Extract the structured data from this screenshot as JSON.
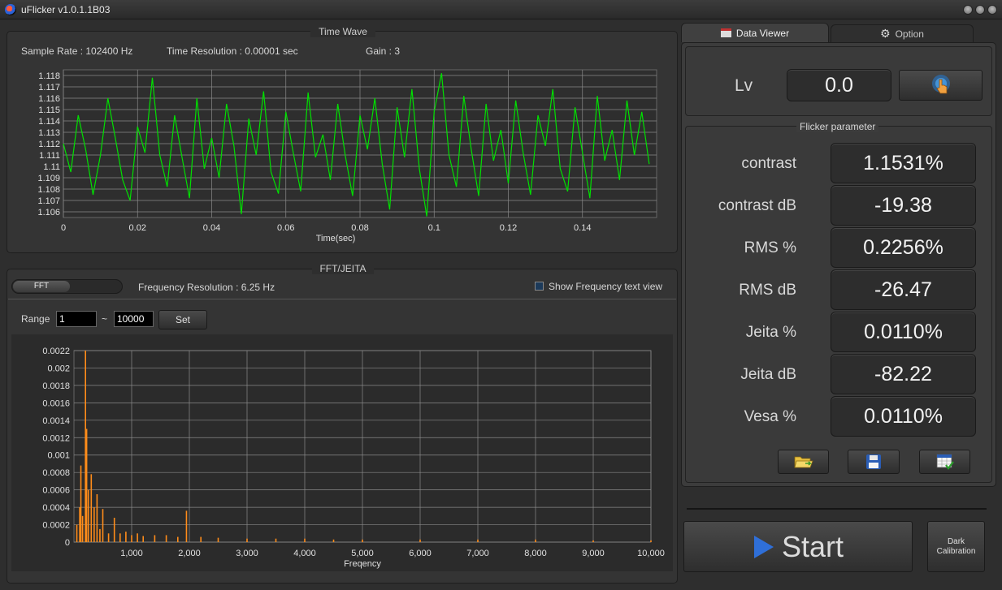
{
  "window": {
    "title": "uFlicker v1.0.1.1B03"
  },
  "time_wave": {
    "title": "Time Wave",
    "sample_rate": "Sample Rate : 102400 Hz",
    "time_resolution": "Time Resolution : 0.00001 sec",
    "gain": "Gain : 3"
  },
  "fft": {
    "title": "FFT/JEITA",
    "mode_label": "FFT",
    "frequency_resolution": "Frequency Resolution : 6.25 Hz",
    "show_text_view": "Show Frequency text view",
    "range_label": "Range",
    "range_from": "1",
    "range_sep": "~",
    "range_to": "10000",
    "set_label": "Set"
  },
  "tabs": {
    "data_viewer": "Data Viewer",
    "option": "Option"
  },
  "lv": {
    "label": "Lv",
    "value": "0.0"
  },
  "flicker": {
    "title": "Flicker parameter",
    "params": [
      {
        "label": "contrast",
        "value": "1.1531%"
      },
      {
        "label": "contrast dB",
        "value": "-19.38"
      },
      {
        "label": "RMS %",
        "value": "0.2256%"
      },
      {
        "label": "RMS dB",
        "value": "-26.47"
      },
      {
        "label": "Jeita %",
        "value": "0.0110%"
      },
      {
        "label": "Jeita dB",
        "value": "-82.22"
      },
      {
        "label": "Vesa %",
        "value": "0.0110%"
      }
    ]
  },
  "actions": {
    "start": "Start",
    "dark_line1": "Dark",
    "dark_line2": "Calibration"
  },
  "icons": {
    "measure": "hand-pointer-icon",
    "open": "folder-open-icon",
    "save": "floppy-disk-icon",
    "export": "table-check-icon",
    "data_viewer": "window-icon",
    "option": "gear-icon"
  },
  "chart_data": [
    {
      "type": "line",
      "xlabel": "Time(sec)",
      "ylabel": "",
      "xlim": [
        0,
        0.16
      ],
      "ylim": [
        1.1055,
        1.1185
      ],
      "xticks": [
        "0",
        "0.02",
        "0.04",
        "0.06",
        "0.08",
        "0.1",
        "0.12",
        "0.14"
      ],
      "yticks": [
        "1.118",
        "1.117",
        "1.116",
        "1.115",
        "1.114",
        "1.113",
        "1.112",
        "1.111",
        "1.11",
        "1.109",
        "1.108",
        "1.107",
        "1.106"
      ],
      "color": "#00e000",
      "series": [
        {
          "x": [
            0,
            0.002,
            0.004,
            0.006,
            0.008,
            0.01,
            0.012,
            0.014,
            0.016,
            0.018,
            0.02,
            0.022,
            0.024,
            0.026,
            0.028,
            0.03,
            0.032,
            0.034,
            0.036,
            0.038,
            0.04,
            0.042,
            0.044,
            0.046,
            0.048,
            0.05,
            0.052,
            0.054,
            0.056,
            0.058,
            0.06,
            0.062,
            0.064,
            0.066,
            0.068,
            0.07,
            0.072,
            0.074,
            0.076,
            0.078,
            0.08,
            0.082,
            0.084,
            0.086,
            0.088,
            0.09,
            0.092,
            0.094,
            0.096,
            0.098,
            0.1,
            0.102,
            0.104,
            0.106,
            0.108,
            0.11,
            0.112,
            0.114,
            0.116,
            0.118,
            0.12,
            0.122,
            0.124,
            0.126,
            0.128,
            0.13,
            0.132,
            0.134,
            0.136,
            0.138,
            0.14,
            0.142,
            0.144,
            0.146,
            0.148,
            0.15,
            0.152,
            0.154,
            0.156,
            0.158
          ],
          "y": [
            1.112,
            1.1095,
            1.1145,
            1.1115,
            1.1075,
            1.111,
            1.116,
            1.1125,
            1.1088,
            1.107,
            1.1135,
            1.1112,
            1.1178,
            1.111,
            1.1082,
            1.1145,
            1.1108,
            1.1072,
            1.116,
            1.1098,
            1.1125,
            1.109,
            1.1155,
            1.1118,
            1.1058,
            1.1142,
            1.111,
            1.1166,
            1.1095,
            1.1076,
            1.1148,
            1.1112,
            1.1078,
            1.1165,
            1.1108,
            1.1128,
            1.1088,
            1.1155,
            1.111,
            1.1074,
            1.1145,
            1.1115,
            1.116,
            1.1102,
            1.1062,
            1.1152,
            1.1108,
            1.1168,
            1.1098,
            1.1056,
            1.1148,
            1.1182,
            1.111,
            1.1082,
            1.1162,
            1.1115,
            1.1074,
            1.1155,
            1.1105,
            1.1132,
            1.1085,
            1.1158,
            1.1112,
            1.1075,
            1.1145,
            1.1118,
            1.1168,
            1.1098,
            1.1078,
            1.1152,
            1.1112,
            1.1072,
            1.1162,
            1.1105,
            1.1132,
            1.1088,
            1.1158,
            1.111,
            1.1148,
            1.1102
          ]
        }
      ]
    },
    {
      "type": "bar",
      "xlabel": "Freqency",
      "ylabel": "",
      "xlim": [
        0,
        10000
      ],
      "ylim": [
        0,
        0.0022
      ],
      "xticks": [
        "1,000",
        "2,000",
        "3,000",
        "4,000",
        "5,000",
        "6,000",
        "7,000",
        "8,000",
        "9,000",
        "10,000"
      ],
      "yticks": [
        "0.0022",
        "0.002",
        "0.0018",
        "0.0016",
        "0.0014",
        "0.0012",
        "0.001",
        "0.0008",
        "0.0006",
        "0.0004",
        "0.0002",
        "0"
      ],
      "color": "#ff8c1a",
      "series": [
        {
          "x": [
            50,
            100,
            120,
            150,
            200,
            220,
            250,
            300,
            350,
            400,
            450,
            500,
            600,
            700,
            800,
            900,
            1000,
            1100,
            1200,
            1400,
            1600,
            1800,
            1950,
            2200,
            2500,
            3000,
            3500,
            4000,
            4500,
            5000,
            6000,
            7000,
            8000,
            9000,
            10000
          ],
          "y": [
            0.0002,
            0.0004,
            0.00088,
            0.0003,
            0.0022,
            0.0013,
            0.0006,
            0.00078,
            0.0004,
            0.00055,
            0.00015,
            0.00038,
            0.0001,
            0.00028,
            0.0001,
            0.00012,
            8e-05,
            0.0001,
            7e-05,
            8e-05,
            8e-05,
            6e-05,
            0.00036,
            6e-05,
            5e-05,
            4e-05,
            4e-05,
            4e-05,
            3e-05,
            3e-05,
            3e-05,
            3e-05,
            3e-05,
            2e-05,
            2e-05
          ]
        }
      ]
    }
  ]
}
